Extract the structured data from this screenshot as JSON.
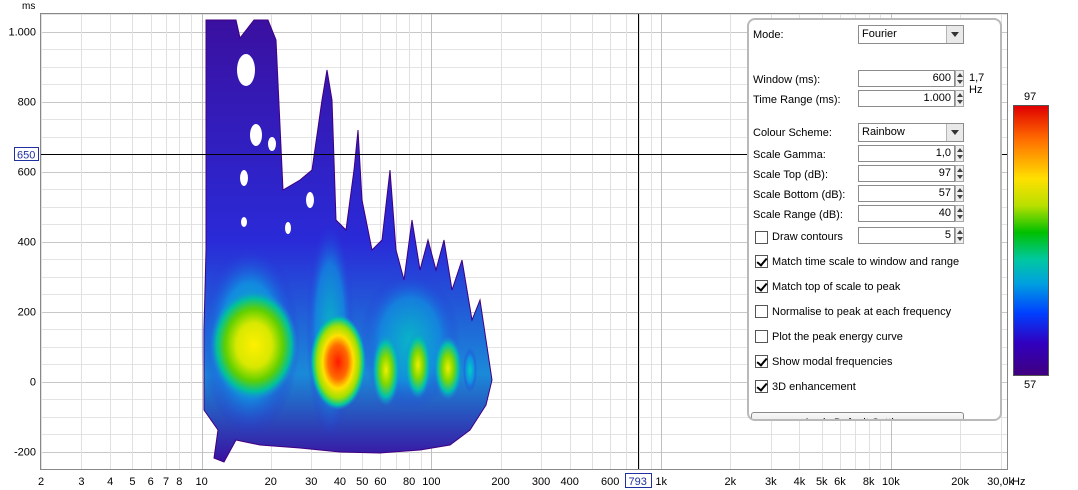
{
  "plot": {
    "y_unit": "ms",
    "x_unit": "Hz",
    "y_ticks": [
      {
        "label": "1.000",
        "v": 1000
      },
      {
        "label": "800",
        "v": 800
      },
      {
        "label": "600",
        "v": 600
      },
      {
        "label": "400",
        "v": 400
      },
      {
        "label": "200",
        "v": 200
      },
      {
        "label": "0",
        "v": 0
      },
      {
        "label": "-200",
        "v": -200
      }
    ],
    "y_range": [
      -250,
      1050
    ],
    "x_range_hz": [
      2,
      32000
    ],
    "x_ticks": [
      {
        "label": "2",
        "f": 2
      },
      {
        "label": "3",
        "f": 3
      },
      {
        "label": "4",
        "f": 4
      },
      {
        "label": "5",
        "f": 5
      },
      {
        "label": "6",
        "f": 6
      },
      {
        "label": "7",
        "f": 7
      },
      {
        "label": "8",
        "f": 8
      },
      {
        "label": "10",
        "f": 10
      },
      {
        "label": "20",
        "f": 20
      },
      {
        "label": "30",
        "f": 30
      },
      {
        "label": "40",
        "f": 40
      },
      {
        "label": "50",
        "f": 50
      },
      {
        "label": "60",
        "f": 60
      },
      {
        "label": "80",
        "f": 80
      },
      {
        "label": "100",
        "f": 100
      },
      {
        "label": "200",
        "f": 200
      },
      {
        "label": "300",
        "f": 300
      },
      {
        "label": "400",
        "f": 400
      },
      {
        "label": "600",
        "f": 600
      },
      {
        "label": "1k",
        "f": 1000
      },
      {
        "label": "2k",
        "f": 2000
      },
      {
        "label": "3k",
        "f": 3000
      },
      {
        "label": "4k",
        "f": 4000
      },
      {
        "label": "5k",
        "f": 5000
      },
      {
        "label": "6k",
        "f": 6000
      },
      {
        "label": "8k",
        "f": 8000
      },
      {
        "label": "10k",
        "f": 10000
      },
      {
        "label": "20k",
        "f": 20000
      },
      {
        "label": "30,0k",
        "f": 30000
      }
    ],
    "cursor_y_label": "650",
    "cursor_y_value": 650,
    "cursor_x_label": "793",
    "cursor_x_hz": 793
  },
  "controls": {
    "mode_label": "Mode:",
    "mode_value": "Fourier",
    "window_label": "Window (ms):",
    "window_value": "600",
    "window_freq": "1,7 Hz",
    "time_range_label": "Time Range (ms):",
    "time_range_value": "1.000",
    "colour_scheme_label": "Colour Scheme:",
    "colour_scheme_value": "Rainbow",
    "scale_gamma_label": "Scale Gamma:",
    "scale_gamma_value": "1,0",
    "scale_top_label": "Scale Top (dB):",
    "scale_top_value": "97",
    "scale_bottom_label": "Scale Bottom (dB):",
    "scale_bottom_value": "57",
    "scale_range_label": "Scale Range (dB):",
    "scale_range_value": "40",
    "draw_contours_label": "Draw contours",
    "draw_contours_checked": false,
    "draw_contours_value": "5",
    "match_time_label": "Match time scale to window and range",
    "match_time_checked": true,
    "match_top_label": "Match top of scale to peak",
    "match_top_checked": true,
    "normalise_label": "Normalise to peak at each frequency",
    "normalise_checked": false,
    "peak_energy_label": "Plot the peak energy curve",
    "peak_energy_checked": false,
    "modal_label": "Show modal frequencies",
    "modal_checked": true,
    "enhance_label": "3D enhancement",
    "enhance_checked": true,
    "apply_label": "Apply Default Settings"
  },
  "color_scale": {
    "top_label": "97",
    "bottom_label": "57"
  }
}
